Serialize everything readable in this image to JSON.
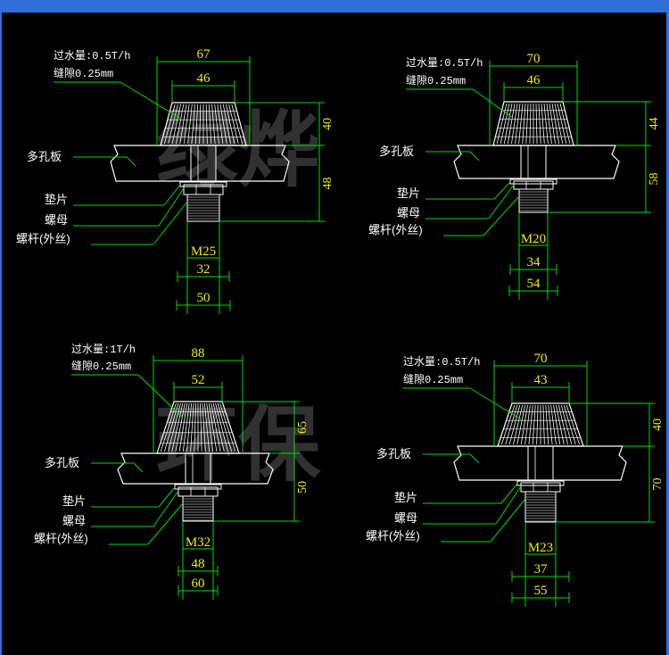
{
  "watermark": {
    "line1": "绿烨",
    "line2": "环保"
  },
  "colors": {
    "background": "#000000",
    "dimension_text": "#f0f000",
    "dimension_line": "#00dd00",
    "leader": "#00dd00",
    "part": "#ffffff",
    "watermark": "#5a5a5a",
    "frame": "#2f6fd8"
  },
  "nozzles": [
    {
      "flow": "过水量:0.5T/h",
      "gap": "缝隙0.25mm",
      "plate_label": "多孔板",
      "washer_label": "垫片",
      "nut_label": "螺母",
      "rod_label": "螺杆(外丝)",
      "outer_diameter": "67",
      "inner_diameter": "46",
      "cap_height": "40",
      "stem_height": "48",
      "thread": "M25",
      "base_width_1": "32",
      "base_width_2": "50"
    },
    {
      "flow": "过水量:0.5T/h",
      "gap": "缝隙0.25mm",
      "plate_label": "多孔板",
      "washer_label": "垫片",
      "nut_label": "螺母",
      "rod_label": "螺杆(外丝)",
      "outer_diameter": "70",
      "inner_diameter": "46",
      "cap_height": "44",
      "stem_height": "58",
      "thread": "M20",
      "base_width_1": "34",
      "base_width_2": "54"
    },
    {
      "flow": "过水量:1T/h",
      "gap": "缝隙0.25mm",
      "plate_label": "多孔板",
      "washer_label": "垫片",
      "nut_label": "螺母",
      "rod_label": "螺杆(外丝)",
      "outer_diameter": "88",
      "inner_diameter": "52",
      "cap_height": "65",
      "stem_height": "50",
      "thread": "M32",
      "base_width_1": "48",
      "base_width_2": "60"
    },
    {
      "flow": "过水量:0.5T/h",
      "gap": "缝隙0.25mm",
      "plate_label": "多孔板",
      "washer_label": "垫片",
      "nut_label": "螺母",
      "rod_label": "螺杆(外丝)",
      "outer_diameter": "70",
      "inner_diameter": "43",
      "cap_height": "40",
      "stem_height": "70",
      "thread": "M23",
      "base_width_1": "37",
      "base_width_2": "55"
    }
  ]
}
